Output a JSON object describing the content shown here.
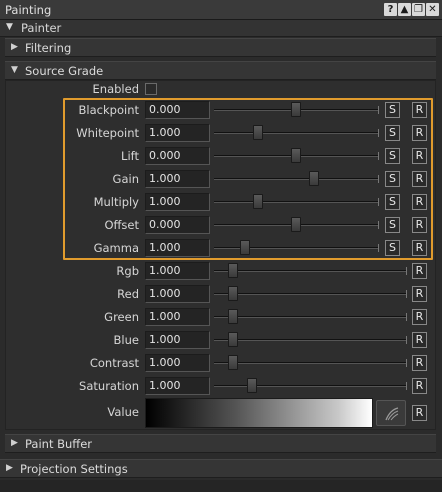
{
  "window": {
    "title": "Painting",
    "icons": [
      "help-icon",
      "float-icon",
      "restore-icon",
      "close-icon"
    ],
    "icon_glyphs": [
      "?",
      "▲",
      "❐",
      "✕"
    ]
  },
  "sections": {
    "painter": {
      "label": "Painter",
      "expanded": true
    },
    "filtering": {
      "label": "Filtering",
      "expanded": false
    },
    "source_grade": {
      "label": "Source Grade",
      "expanded": true
    },
    "paint_buffer": {
      "label": "Paint Buffer",
      "expanded": false
    },
    "projection_settings": {
      "label": "Projection Settings",
      "expanded": false
    }
  },
  "source_grade": {
    "enabled_label": "Enabled",
    "enabled": false,
    "rows": [
      {
        "label": "Blackpoint",
        "value": "0.000",
        "slider": 0.5,
        "has_s": true
      },
      {
        "label": "Whitepoint",
        "value": "1.000",
        "slider": 0.27,
        "has_s": true
      },
      {
        "label": "Lift",
        "value": "0.000",
        "slider": 0.5,
        "has_s": true
      },
      {
        "label": "Gain",
        "value": "1.000",
        "slider": 0.61,
        "has_s": true
      },
      {
        "label": "Multiply",
        "value": "1.000",
        "slider": 0.27,
        "has_s": true
      },
      {
        "label": "Offset",
        "value": "0.000",
        "slider": 0.5,
        "has_s": true
      },
      {
        "label": "Gamma",
        "value": "1.000",
        "slider": 0.19,
        "has_s": true
      },
      {
        "label": "Rgb",
        "value": "1.000",
        "slider": 0.1,
        "has_s": false
      },
      {
        "label": "Red",
        "value": "1.000",
        "slider": 0.1,
        "has_s": false
      },
      {
        "label": "Green",
        "value": "1.000",
        "slider": 0.1,
        "has_s": false
      },
      {
        "label": "Blue",
        "value": "1.000",
        "slider": 0.1,
        "has_s": false
      },
      {
        "label": "Contrast",
        "value": "1.000",
        "slider": 0.1,
        "has_s": false
      },
      {
        "label": "Saturation",
        "value": "1.000",
        "slider": 0.2,
        "has_s": false
      }
    ],
    "value_label": "Value",
    "s_label": "S",
    "r_label": "R"
  },
  "colors": {
    "highlight": "#e09b2d",
    "background": "#2b2b2b"
  }
}
